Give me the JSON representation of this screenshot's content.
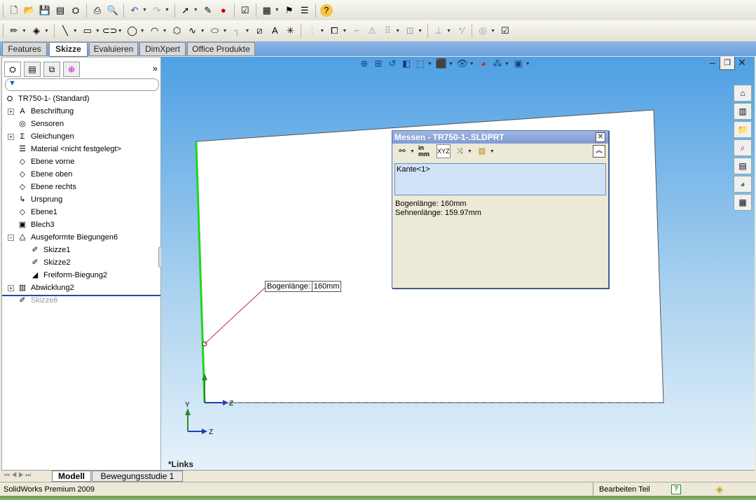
{
  "tabs": [
    "Features",
    "Skizze",
    "Evaluieren",
    "DimXpert",
    "Office Produkte"
  ],
  "active_tab": "Skizze",
  "tree": [
    {
      "label": "TR750-1-  (Standard)",
      "icon": "part-icon",
      "level": 0,
      "expand": ""
    },
    {
      "label": "Beschriftung",
      "icon": "annotation-icon",
      "level": 1,
      "expand": "+"
    },
    {
      "label": "Sensoren",
      "icon": "sensor-icon",
      "level": 1,
      "expand": ""
    },
    {
      "label": "Gleichungen",
      "icon": "equation-icon",
      "level": 1,
      "expand": "+"
    },
    {
      "label": "Material <nicht festgelegt>",
      "icon": "material-icon",
      "level": 1,
      "expand": ""
    },
    {
      "label": "Ebene vorne",
      "icon": "plane-icon",
      "level": 1,
      "expand": ""
    },
    {
      "label": "Ebene oben",
      "icon": "plane-icon",
      "level": 1,
      "expand": ""
    },
    {
      "label": "Ebene rechts",
      "icon": "plane-icon",
      "level": 1,
      "expand": ""
    },
    {
      "label": "Ursprung",
      "icon": "origin-icon",
      "level": 1,
      "expand": ""
    },
    {
      "label": "Ebene1",
      "icon": "plane-icon",
      "level": 1,
      "expand": ""
    },
    {
      "label": "Blech3",
      "icon": "sheetmetal-icon",
      "level": 1,
      "expand": ""
    },
    {
      "label": "Ausgeformte Biegungen6",
      "icon": "lofted-bend-icon",
      "level": 1,
      "expand": "−"
    },
    {
      "label": "Skizze1",
      "icon": "sketch-icon",
      "level": 2,
      "expand": ""
    },
    {
      "label": "Skizze2",
      "icon": "sketch-icon",
      "level": 2,
      "expand": ""
    },
    {
      "label": "Freiform-Biegung2",
      "icon": "freeform-bend-icon",
      "level": 2,
      "expand": ""
    },
    {
      "label": "Abwicklung2",
      "icon": "flatten-icon",
      "level": 1,
      "expand": "+"
    },
    {
      "label": "Skizze6",
      "icon": "sketch-icon",
      "level": 1,
      "expand": "",
      "grey": true
    }
  ],
  "bottom_tabs": [
    "Modell",
    "Bewegungsstudie 1"
  ],
  "status": {
    "left": "SolidWorks Premium 2009",
    "right": "Bearbeiten Teil"
  },
  "measure": {
    "title": "Messen - TR750-1-.SLDPRT",
    "selection": "Kante<1>",
    "units_button": "in mm",
    "results": [
      "Bogenlänge: 160mm",
      "Sehnenlänge: 159.97mm"
    ]
  },
  "callout": {
    "label": "Bogenlänge:",
    "value": "160mm"
  },
  "view_name": "*Links",
  "axes": {
    "y": "Y",
    "z": "Z"
  }
}
